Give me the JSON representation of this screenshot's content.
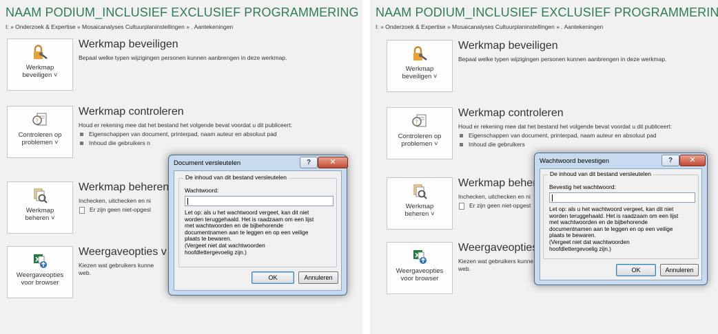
{
  "left": {
    "title": "NAAM PODIUM_INCLUSIEF EXCLUSIEF PROGRAMMERING CULTUURP",
    "breadcrumb": "I: » Onderzoek & Expertise » Mosaicanalyses Cultuurplaninstellingen » . Aantekeningen",
    "protect": {
      "tile_line1": "Werkmap",
      "tile_line2": "beveiligen ˅",
      "heading": "Werkmap beveiligen",
      "description": "Bepaal welke typen wijzigingen personen kunnen aanbrengen in deze werkmap."
    },
    "inspect": {
      "tile_line1": "Controleren op",
      "tile_line2": "problemen ˅",
      "heading": "Werkmap controleren",
      "description": "Houd er rekening mee dat het bestand het volgende bevat voordat u dit publiceert:",
      "bullet1": "Eigenschappen van document, printerpad, naam auteur en absoluut pad",
      "bullet2": "Inhoud die gebruikers n"
    },
    "manage": {
      "tile_line1": "Werkmap",
      "tile_line2": "beheren ˅",
      "heading": "Werkmap beheren",
      "description": "Inchecken, uitchecken en ni",
      "item": "Er zijn geen niet-opgesl"
    },
    "browser": {
      "tile_line1": "Weergaveopties",
      "tile_line2": "voor browser",
      "heading": "Weergaveopties v",
      "description_line1": "Kiezen wat gebruikers kunne",
      "description_line2": "web."
    },
    "dialog": {
      "title": "Document versleutelen",
      "help_label": "?",
      "close_label": "✕",
      "group_label": "De inhoud van dit bestand versleutelen",
      "field_label": "Wachtwoord:",
      "password_value": "",
      "warning": [
        "Let op: als u het wachtwoord vergeet, kan dit niet",
        "worden teruggehaald. Het is raadzaam om een lijst",
        "met wachtwoorden en de bijbehorende",
        "documentnamen aan te leggen en op een veilige",
        "plaats te bewaren.",
        "(Vergeet niet dat wachtwoorden",
        "hoofdlettergevoelig zijn.)"
      ],
      "ok_label": "OK",
      "cancel_label": "Annuleren"
    }
  },
  "right": {
    "title": "NAAM PODIUM_INCLUSIEF EXCLUSIEF PROGRAMMERING CULTUUF",
    "breadcrumb": "I: » Onderzoek & Expertise » Mosaicanalyses Cultuurplaninstellingen » . Aantekeningen",
    "protect": {
      "tile_line1": "Werkmap",
      "tile_line2": "beveiligen ˅",
      "heading": "Werkmap beveiligen",
      "description": "Bepaal welke typen wijzigingen personen kunnen aanbrengen in deze werkmap."
    },
    "inspect": {
      "tile_line1": "Controleren op",
      "tile_line2": "problemen ˅",
      "heading": "Werkmap controleren",
      "description": "Houd er rekening mee dat het bestand het volgende bevat voordat u dit publiceert:",
      "bullet1": "Eigenschappen van document, printerpad, naam auteur en absoluut pad",
      "bullet2": "Inhoud die gebruikers"
    },
    "manage": {
      "tile_line1": "Werkmap",
      "tile_line2": "beheren ˅",
      "heading": "Werkmap beheren",
      "description": "Inchecken, uitchecken en ni",
      "item": "Er zijn geen niet-opgest"
    },
    "browser": {
      "tile_line1": "Weergaveopties",
      "tile_line2": "voor browser",
      "heading": "Weergaveopties v",
      "description_line1": "Kiezen wat gebruikers kunne",
      "description_line2": "web."
    },
    "dialog": {
      "title": "Wachtwoord bevestigen",
      "help_label": "?",
      "close_label": "✕",
      "group_label": "De inhoud van dit bestand versleutelen",
      "field_label": "Bevestig het wachtwoord:",
      "password_value": "",
      "warning": [
        "Let op: als u het wachtwoord vergeet, kan dit niet",
        "worden teruggehaald. Het is raadzaam om een lijst",
        "met wachtwoorden en de bijbehorende",
        "documentnamen aan te leggen en op een veilige",
        "plaats te bewaren.",
        "(Vergeet niet dat wachtwoorden",
        "hoofdlettergevoelig zijn.)"
      ],
      "ok_label": "OK",
      "cancel_label": "Annuleren"
    }
  }
}
